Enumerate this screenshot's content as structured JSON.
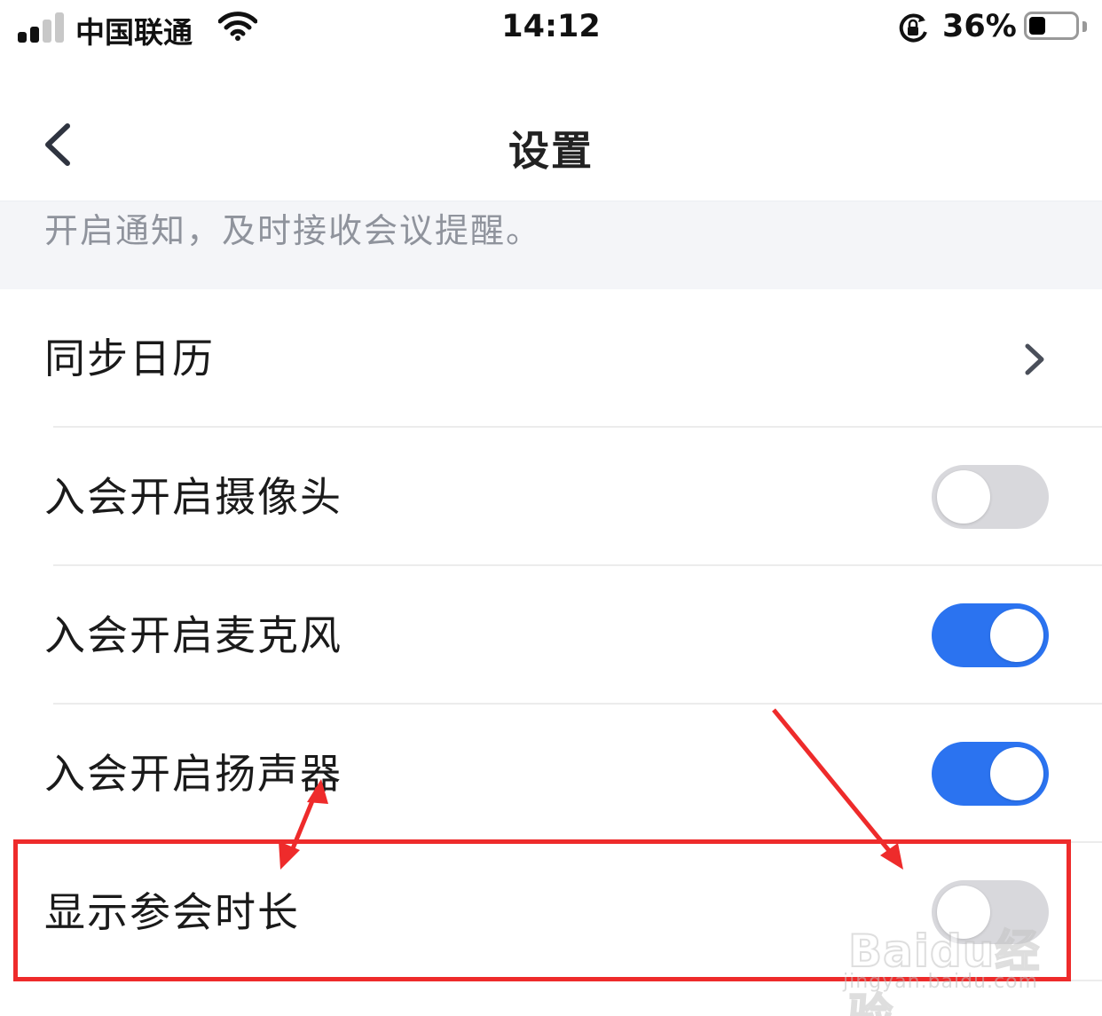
{
  "status_bar": {
    "carrier": "中国联通",
    "time": "14:12",
    "battery_percent": "36%",
    "battery_level": 0.36,
    "icons": [
      "signal-icon",
      "wifi-icon",
      "rotation-lock-icon",
      "battery-icon"
    ]
  },
  "nav": {
    "title": "设置",
    "back_icon": "chevron-left-icon"
  },
  "notice": {
    "text": "开启通知，及时接收会议提醒。"
  },
  "settings": [
    {
      "label": "同步日历",
      "control": "chevron",
      "icon": "chevron-right-icon"
    },
    {
      "label": "入会开启摄像头",
      "control": "toggle",
      "on": false
    },
    {
      "label": "入会开启麦克风",
      "control": "toggle",
      "on": true
    },
    {
      "label": "入会开启扬声器",
      "control": "toggle",
      "on": true
    },
    {
      "label": "显示参会时长",
      "control": "toggle",
      "on": false
    }
  ],
  "colors": {
    "toggle_on": "#2b73f0",
    "toggle_off": "#d8d8dc",
    "annotation": "#ee2b2b",
    "notice_bg": "#f4f5f8"
  },
  "watermark": {
    "brand": "Baidu经验",
    "url": "jingyan.baidu.com"
  }
}
